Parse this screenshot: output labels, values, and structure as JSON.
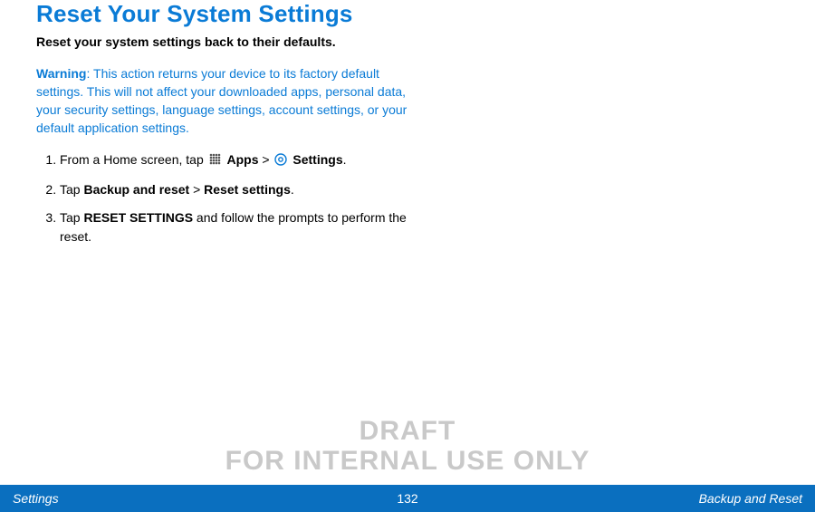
{
  "title": "Reset Your System Settings",
  "subtitle": "Reset your system settings back to their defaults.",
  "warning": {
    "label": "Warning",
    "sep": ": ",
    "text": "This action returns your device to its factory default settings. This will not affect your downloaded apps, personal data, your security settings, language settings, account settings, or your default application settings."
  },
  "steps": {
    "s1": {
      "prefix": "From a Home screen, tap ",
      "apps": "Apps",
      "sep": " > ",
      "settings": "Settings",
      "suffix": "."
    },
    "s2": {
      "prefix": "Tap ",
      "a": "Backup and reset",
      "sep": " > ",
      "b": "Reset settings",
      "suffix": "."
    },
    "s3": {
      "prefix": "Tap ",
      "a": "RESET SETTINGS",
      "suffix": " and follow the prompts to perform the reset."
    }
  },
  "watermark": {
    "line1": "DRAFT",
    "line2": "FOR INTERNAL USE ONLY"
  },
  "footer": {
    "left": "Settings",
    "page": "132",
    "right": "Backup and Reset"
  }
}
